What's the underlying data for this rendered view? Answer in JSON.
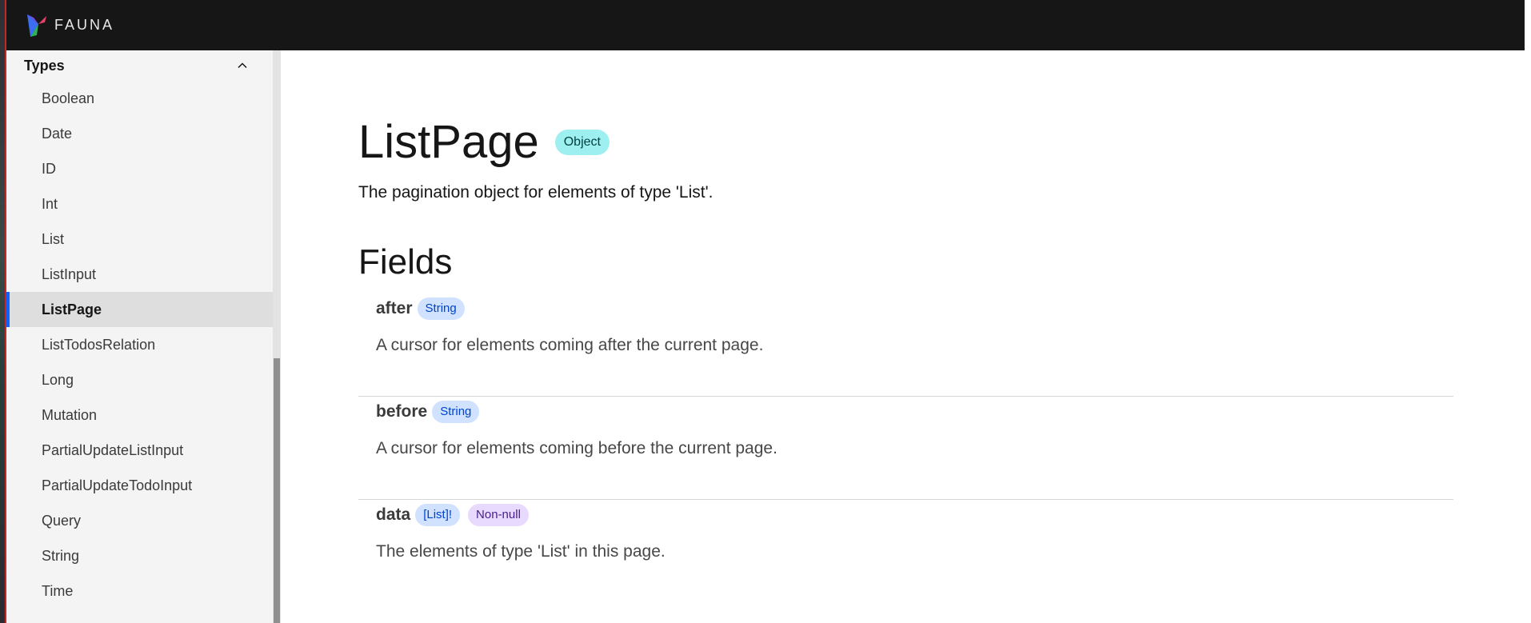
{
  "brand": {
    "name": "FAUNA"
  },
  "sidebar": {
    "section_title": "Types",
    "items": [
      {
        "label": "Boolean"
      },
      {
        "label": "Date"
      },
      {
        "label": "ID"
      },
      {
        "label": "Int"
      },
      {
        "label": "List"
      },
      {
        "label": "ListInput"
      },
      {
        "label": "ListPage",
        "active": true
      },
      {
        "label": "ListTodosRelation"
      },
      {
        "label": "Long"
      },
      {
        "label": "Mutation"
      },
      {
        "label": "PartialUpdateListInput"
      },
      {
        "label": "PartialUpdateTodoInput"
      },
      {
        "label": "Query"
      },
      {
        "label": "String"
      },
      {
        "label": "Time"
      }
    ]
  },
  "main": {
    "title": "ListPage",
    "kind_tag": "Object",
    "description": "The pagination object for elements of type 'List'.",
    "fields_heading": "Fields",
    "fields": [
      {
        "name": "after",
        "type": "String",
        "description": "A cursor for elements coming after the current page."
      },
      {
        "name": "before",
        "type": "String",
        "description": "A cursor for elements coming before the current page."
      },
      {
        "name": "data",
        "type": "[List]!",
        "modifier": "Non-null",
        "description": "The elements of type 'List' in this page."
      }
    ]
  },
  "colors": {
    "topbar": "#161616",
    "sidebar_bg": "#f4f4f4",
    "active_indicator": "#0f62fe",
    "object_tag": "#9ef0f0",
    "type_tag": "#d0e2ff",
    "nonnull_tag": "#e8daff"
  }
}
